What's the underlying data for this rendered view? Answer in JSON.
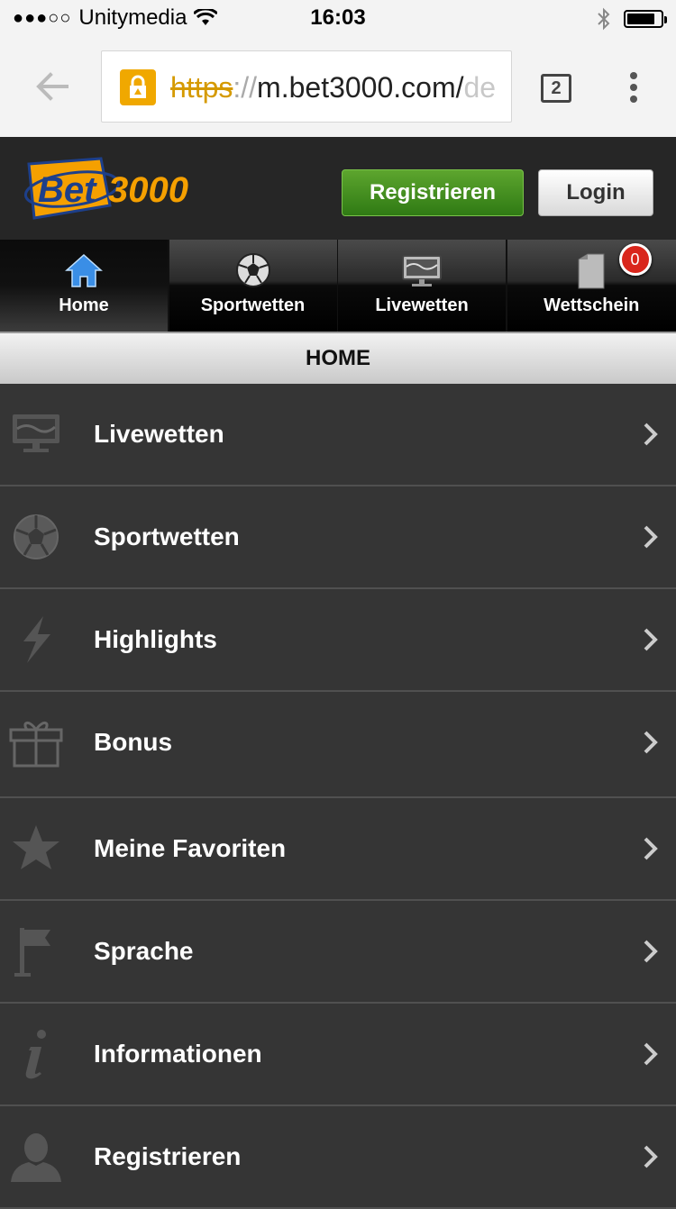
{
  "status": {
    "carrier": "Unitymedia",
    "time": "16:03",
    "signal": "●●●○○"
  },
  "browser": {
    "url_scheme": "https",
    "url_sep": "://",
    "url_host": "m.bet3000.com/",
    "url_fade": "de",
    "tab_count": "2"
  },
  "header": {
    "logo_text_a": "Bet",
    "logo_text_b": "3000",
    "register_label": "Registrieren",
    "login_label": "Login"
  },
  "nav": {
    "tabs": [
      {
        "label": "Home",
        "icon": "home-icon"
      },
      {
        "label": "Sportwetten",
        "icon": "soccer-ball-icon"
      },
      {
        "label": "Livewetten",
        "icon": "monitor-icon"
      },
      {
        "label": "Wettschein",
        "icon": "document-icon"
      }
    ],
    "betslip_count": "0"
  },
  "section_title": "HOME",
  "menu": {
    "items": [
      {
        "label": "Livewetten",
        "icon": "monitor-icon"
      },
      {
        "label": "Sportwetten",
        "icon": "soccer-ball-icon"
      },
      {
        "label": "Highlights",
        "icon": "lightning-icon"
      },
      {
        "label": "Bonus",
        "icon": "gift-icon"
      },
      {
        "label": "Meine Favoriten",
        "icon": "star-icon"
      },
      {
        "label": "Sprache",
        "icon": "flag-icon"
      },
      {
        "label": "Informationen",
        "icon": "info-icon"
      },
      {
        "label": "Registrieren",
        "icon": "user-icon"
      }
    ]
  },
  "colors": {
    "accent_green": "#3d8c1e",
    "logo_orange": "#f5a000",
    "badge_red": "#d9261c"
  }
}
